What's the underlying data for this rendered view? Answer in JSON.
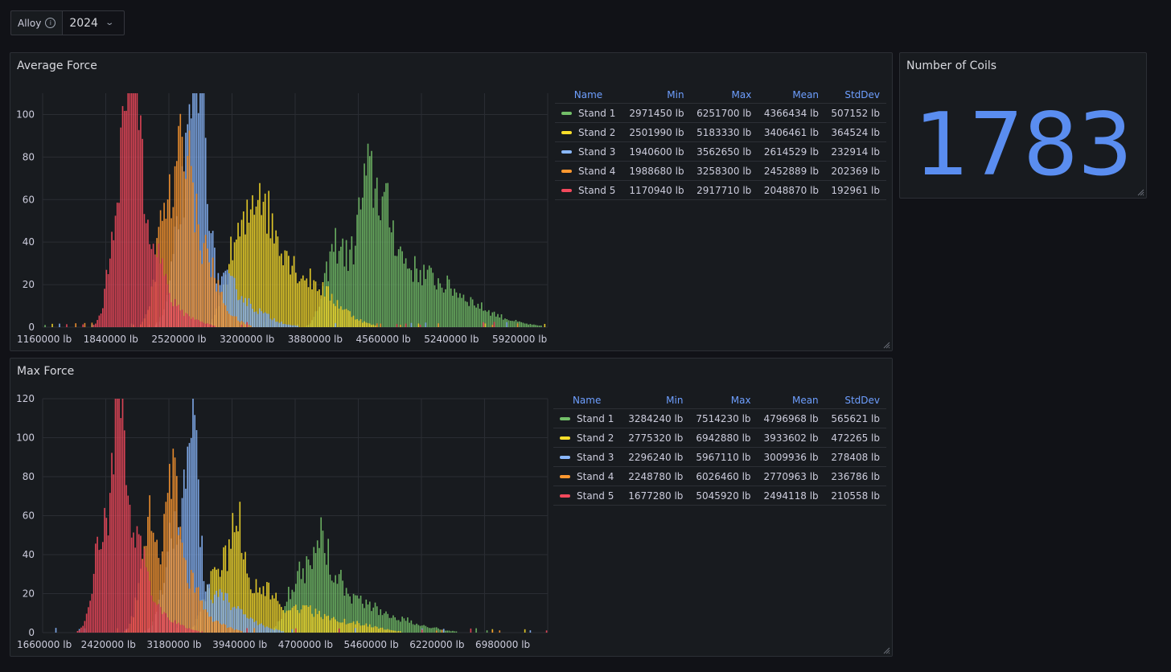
{
  "variable": {
    "label": "Alloy",
    "info_icon": "info-icon",
    "value": "2024",
    "chevron_icon": "chevron-down-icon"
  },
  "colors": {
    "stand1": "#73bf69",
    "stand2": "#fade2a",
    "stand3": "#8ab8ff",
    "stand4": "#ff9830",
    "stand5": "#f2495c",
    "stat": "#5a8df0"
  },
  "stat_panel": {
    "title": "Number of Coils",
    "value": "1783"
  },
  "legend_headers": [
    "Name",
    "Min",
    "Max",
    "Mean",
    "StdDev"
  ],
  "avg_panel": {
    "title": "Average Force",
    "legend": [
      {
        "name": "Stand 1",
        "min": "2971450 lb",
        "max": "6251700 lb",
        "mean": "4366434 lb",
        "std": "507152 lb"
      },
      {
        "name": "Stand 2",
        "min": "2501990 lb",
        "max": "5183330 lb",
        "mean": "3406461 lb",
        "std": "364524 lb"
      },
      {
        "name": "Stand 3",
        "min": "1940600 lb",
        "max": "3562650 lb",
        "mean": "2614529 lb",
        "std": "232914 lb"
      },
      {
        "name": "Stand 4",
        "min": "1988680 lb",
        "max": "3258300 lb",
        "mean": "2452889 lb",
        "std": "202369 lb"
      },
      {
        "name": "Stand 5",
        "min": "1170940 lb",
        "max": "2917710 lb",
        "mean": "2048870 lb",
        "std": "192961 lb"
      }
    ]
  },
  "max_panel": {
    "title": "Max Force",
    "legend": [
      {
        "name": "Stand 1",
        "min": "3284240 lb",
        "max": "7514230 lb",
        "mean": "4796968 lb",
        "std": "565621 lb"
      },
      {
        "name": "Stand 2",
        "min": "2775320 lb",
        "max": "6942880 lb",
        "mean": "3933602 lb",
        "std": "472265 lb"
      },
      {
        "name": "Stand 3",
        "min": "2296240 lb",
        "max": "5967110 lb",
        "mean": "3009936 lb",
        "std": "278408 lb"
      },
      {
        "name": "Stand 4",
        "min": "2248780 lb",
        "max": "6026460 lb",
        "mean": "2770963 lb",
        "std": "236786 lb"
      },
      {
        "name": "Stand 5",
        "min": "1677280 lb",
        "max": "5045920 lb",
        "mean": "2494118 lb",
        "std": "210558 lb"
      }
    ]
  },
  "chart_data": [
    {
      "type": "bar",
      "subtype": "histogram",
      "title": "Average Force",
      "x_unit": "lb",
      "x_range": [
        1160000,
        6200000
      ],
      "x_ticks": [
        1160000,
        1840000,
        2520000,
        3200000,
        3880000,
        4560000,
        5240000,
        5920000
      ],
      "x_tick_labels": [
        "1160000 lb",
        "1840000 lb",
        "2520000 lb",
        "3200000 lb",
        "3880000 lb",
        "4560000 lb",
        "5240000 lb",
        "5920000 lb"
      ],
      "y_range": [
        0,
        110
      ],
      "y_ticks": [
        0,
        20,
        40,
        60,
        80,
        100
      ],
      "grid": true,
      "legend_placement": "right",
      "series": [
        {
          "name": "Stand 1",
          "color": "#73bf69",
          "peaks": [
            [
              4100000,
              40,
              110000
            ],
            [
              4380000,
              54,
              90000
            ],
            [
              4560000,
              40,
              110000
            ],
            [
              4750000,
              19,
              200000
            ],
            [
              5100000,
              16,
              260000
            ],
            [
              5500000,
              6,
              300000
            ]
          ]
        },
        {
          "name": "Stand 2",
          "color": "#fade2a",
          "peaks": [
            [
              3100000,
              40,
              110000
            ],
            [
              3320000,
              57,
              90000
            ],
            [
              3520000,
              30,
              110000
            ],
            [
              3760000,
              19,
              180000
            ],
            [
              4050000,
              9,
              200000
            ]
          ]
        },
        {
          "name": "Stand 3",
          "color": "#8ab8ff",
          "peaks": [
            [
              2600000,
              68,
              110000
            ],
            [
              2740000,
              90,
              65000
            ],
            [
              2950000,
              20,
              160000
            ],
            [
              3250000,
              7,
              200000
            ]
          ]
        },
        {
          "name": "Stand 4",
          "color": "#ff9830",
          "peaks": [
            [
              2390000,
              57,
              90000
            ],
            [
              2580000,
              77,
              70000
            ],
            [
              2740000,
              32,
              120000
            ],
            [
              2900000,
              8,
              160000
            ]
          ]
        },
        {
          "name": "Stand 5",
          "color": "#f2495c",
          "peaks": [
            [
              1930000,
              64,
              90000
            ],
            [
              2070000,
              96,
              70000
            ],
            [
              2230000,
              42,
              110000
            ],
            [
              2450000,
              8,
              200000
            ]
          ]
        }
      ]
    },
    {
      "type": "bar",
      "subtype": "histogram",
      "title": "Max Force",
      "x_unit": "lb",
      "x_range": [
        1660000,
        7500000
      ],
      "x_ticks": [
        1660000,
        2420000,
        3180000,
        3940000,
        4700000,
        5460000,
        6220000,
        6980000
      ],
      "x_tick_labels": [
        "1660000 lb",
        "2420000 lb",
        "3180000 lb",
        "3940000 lb",
        "4700000 lb",
        "5460000 lb",
        "6220000 lb",
        "6980000 lb"
      ],
      "y_range": [
        0,
        120
      ],
      "y_ticks": [
        0,
        20,
        40,
        60,
        80,
        100,
        120
      ],
      "grid": true,
      "legend_placement": "right",
      "series": [
        {
          "name": "Stand 1",
          "color": "#73bf69",
          "peaks": [
            [
              4600000,
              28,
              120000
            ],
            [
              4850000,
              40,
              100000
            ],
            [
              5050000,
              22,
              140000
            ],
            [
              5350000,
              12,
              220000
            ],
            [
              5800000,
              6,
              300000
            ]
          ]
        },
        {
          "name": "Stand 2",
          "color": "#fade2a",
          "peaks": [
            [
              3650000,
              34,
              110000
            ],
            [
              3900000,
              50,
              90000
            ],
            [
              4150000,
              22,
              160000
            ],
            [
              4600000,
              12,
              250000
            ],
            [
              5200000,
              5,
              300000
            ]
          ]
        },
        {
          "name": "Stand 3",
          "color": "#8ab8ff",
          "peaks": [
            [
              3200000,
              58,
              120000
            ],
            [
              3400000,
              86,
              70000
            ],
            [
              3650000,
              18,
              180000
            ],
            [
              4000000,
              6,
              220000
            ]
          ]
        },
        {
          "name": "Stand 4",
          "color": "#ff9830",
          "peaks": [
            [
              2900000,
              60,
              100000
            ],
            [
              3150000,
              84,
              70000
            ],
            [
              3350000,
              25,
              120000
            ],
            [
              3600000,
              6,
              180000
            ]
          ]
        },
        {
          "name": "Stand 5",
          "color": "#f2495c",
          "peaks": [
            [
              2350000,
              52,
              100000
            ],
            [
              2550000,
              102,
              70000
            ],
            [
              2750000,
              44,
              120000
            ],
            [
              3050000,
              8,
              200000
            ]
          ]
        }
      ]
    }
  ]
}
